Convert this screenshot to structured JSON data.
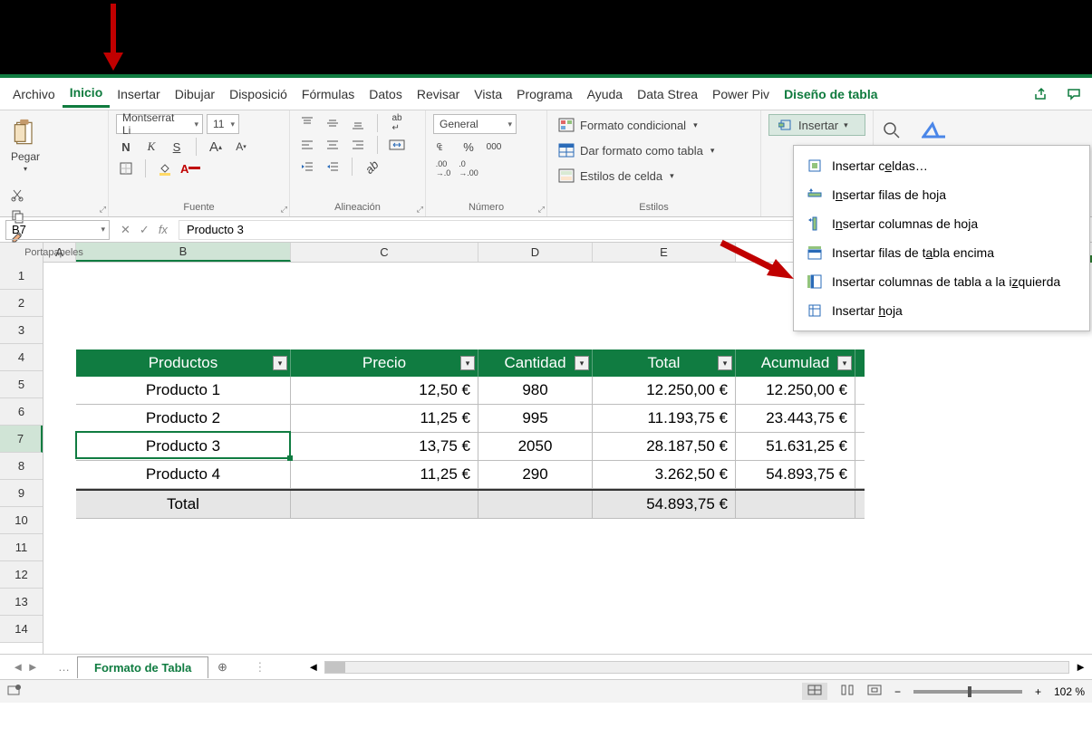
{
  "tabs": {
    "items": [
      "Archivo",
      "Inicio",
      "Insertar",
      "Dibujar",
      "Disposició",
      "Fórmulas",
      "Datos",
      "Revisar",
      "Vista",
      "Programa",
      "Ayuda",
      "Data Strea",
      "Power Piv"
    ],
    "design": "Diseño de tabla",
    "active_index": 1
  },
  "ribbon": {
    "clipboard": {
      "paste": "Pegar",
      "title": "Portapapeles"
    },
    "font": {
      "name": "Montserrat Li",
      "size": "11",
      "title": "Fuente",
      "bold": "N",
      "italic": "K",
      "underline": "S"
    },
    "alignment": {
      "title": "Alineación"
    },
    "number": {
      "format": "General",
      "title": "Número",
      "percent": "%",
      "thousands": "000"
    },
    "styles": {
      "title": "Estilos",
      "conditional": "Formato condicional",
      "as_table": "Dar formato como tabla",
      "cell_styles": "Estilos de celda"
    },
    "cells": {
      "insert": "Insertar"
    }
  },
  "insert_menu": {
    "cells": "Insertar celdas…",
    "sheet_rows": "Insertar filas de hoja",
    "sheet_cols": "Insertar columnas de hoja",
    "table_rows_above": "Insertar filas de tabla encima",
    "table_cols_left": "Insertar columnas de tabla a la izquierda",
    "insert_sheet": "Insertar hoja"
  },
  "namebox": {
    "ref": "B7",
    "formula": "Producto 3",
    "fx": "fx"
  },
  "columns": {
    "A": "A",
    "B": "B",
    "C": "C",
    "D": "D",
    "E": "E"
  },
  "rows": [
    "1",
    "2",
    "3",
    "4",
    "5",
    "6",
    "7",
    "8",
    "9",
    "10",
    "11",
    "12",
    "13",
    "14"
  ],
  "table": {
    "headers": {
      "prod": "Productos",
      "prec": "Precio",
      "cant": "Cantidad",
      "tot": "Total",
      "acum": "Acumulad"
    },
    "rows": [
      {
        "prod": "Producto 1",
        "prec": "12,50 €",
        "cant": "980",
        "tot": "12.250,00 €",
        "acum": "12.250,00 €"
      },
      {
        "prod": "Producto 2",
        "prec": "11,25 €",
        "cant": "995",
        "tot": "11.193,75 €",
        "acum": "23.443,75 €"
      },
      {
        "prod": "Producto 3",
        "prec": "13,75 €",
        "cant": "2050",
        "tot": "28.187,50 €",
        "acum": "51.631,25 €"
      },
      {
        "prod": "Producto 4",
        "prec": "11,25 €",
        "cant": "290",
        "tot": "3.262,50 €",
        "acum": "54.893,75 €"
      }
    ],
    "total": {
      "label": "Total",
      "value": "54.893,75 €"
    }
  },
  "sheet_tab": {
    "name": "Formato de Tabla",
    "nav": "…"
  },
  "status": {
    "zoom": "102 %"
  },
  "accel": {
    "cells_u": "e",
    "rows_u": "n",
    "cols_u": "n",
    "trows_u": "a",
    "tcols_u": "z",
    "sheet_u": "h"
  }
}
